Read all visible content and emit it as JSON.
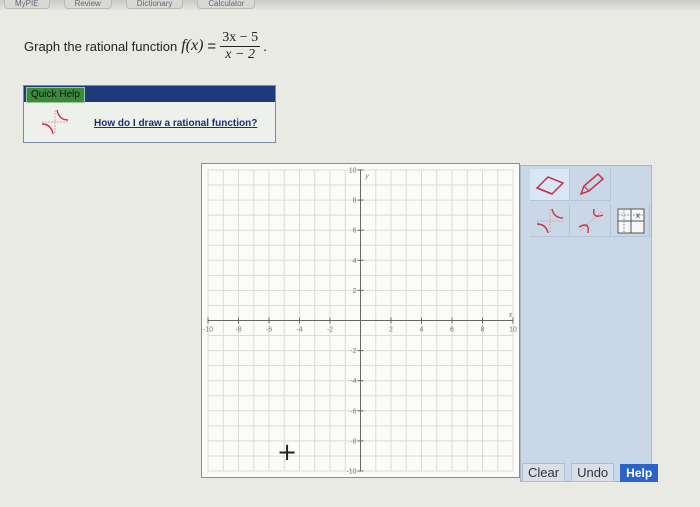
{
  "topbar": {
    "tabs": [
      "MyPIE",
      "Review",
      "Dictionary",
      "Calculator"
    ]
  },
  "question": {
    "prompt": "Graph the rational function",
    "function_name": "f(x)",
    "equals": "=",
    "numerator": "3x − 5",
    "denominator": "x − 2",
    "end": "."
  },
  "quick_help": {
    "title": "Quick Help",
    "link": "How do I draw a rational function?",
    "icon": "rational-graph-icon"
  },
  "graph": {
    "x_range": [
      -10,
      10
    ],
    "y_range": [
      -10,
      10
    ],
    "x_axis_label": "x",
    "y_axis_label": "y",
    "x_tick_labels": [
      "-10",
      "-8",
      "-6",
      "-4",
      "-2",
      "2",
      "4",
      "6",
      "8",
      "10"
    ],
    "y_tick_labels": [
      "10",
      "8",
      "6",
      "4",
      "2",
      "-2",
      "-4",
      "-6",
      "-8",
      "-10"
    ],
    "grid": true
  },
  "tools": {
    "items": [
      "eraser-icon",
      "pencil-icon",
      "rational-graph-tool-icon",
      "rational-graph-tool-2-icon",
      "asymptote-grid-icon"
    ]
  },
  "buttons": {
    "clear": "Clear",
    "undo": "Undo",
    "help": "Help"
  },
  "colors": {
    "quick_help_header": "#1e3a7b",
    "help_button": "#2c63c6",
    "tool_icon": "#c8324b"
  }
}
